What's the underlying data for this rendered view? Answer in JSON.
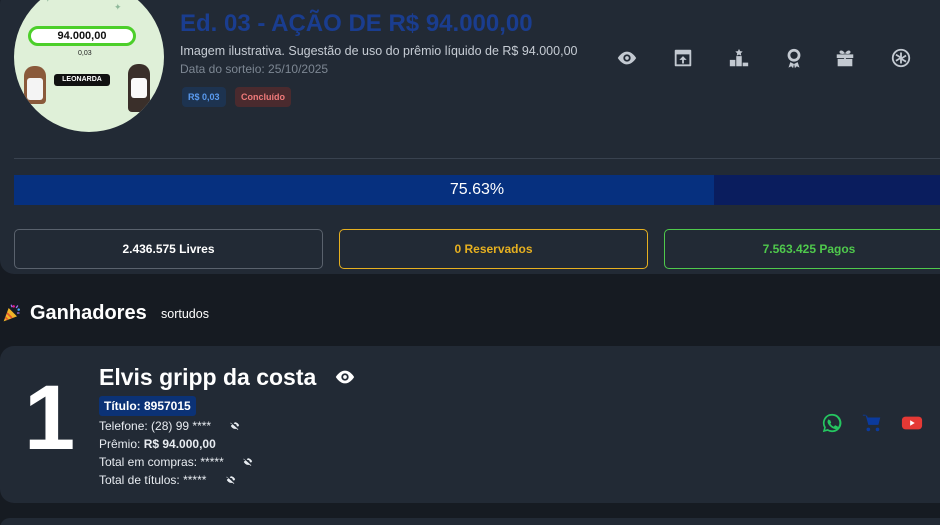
{
  "raffle": {
    "title": "Ed. 03 - AÇÃO DE R$ 94.000,00",
    "subtitle": "Imagem ilustrativa. Sugestão de uso do prêmio líquido de R$ 94.000,00",
    "draw_date": "Data do sorteio: 25/10/2025",
    "price_badge": "R$ 0,03",
    "status_badge": "Concluído",
    "thumbnail": {
      "prize_text": "94.000,00",
      "small_text": "0,03",
      "logo_text": "LEONARDA"
    }
  },
  "actions": [
    {
      "name": "view-icon"
    },
    {
      "name": "share-icon"
    },
    {
      "name": "ranking-icon"
    },
    {
      "name": "award-icon"
    },
    {
      "name": "gift-icon"
    },
    {
      "name": "wheel-icon"
    }
  ],
  "progress": {
    "label": "75.63%",
    "fraction": 0.7563
  },
  "stats": {
    "free": "2.436.575 Livres",
    "reserved": "0 Reservados",
    "paid": "7.563.425 Pagos"
  },
  "winners": {
    "title": "Ganhadores",
    "subtitle": "sortudos",
    "items": [
      {
        "position": "1",
        "name": "Elvis gripp da costa",
        "ticket": "Título: 8957015",
        "phone_label": "Telefone:",
        "phone_value": "(28) 99 ****",
        "prize_label": "Prêmio:",
        "prize_value": "R$ 94.000,00",
        "total_label": "Total em compras:",
        "total_value": "*****",
        "titles_label": "Total de títulos:",
        "titles_value": "*****"
      }
    ]
  },
  "colors": {
    "title": "#1a3d8f",
    "progress_fill": "#06307f",
    "reserved": "#e6b020",
    "paid": "#4fc94c",
    "whatsapp": "#25c660",
    "youtube": "#e53935",
    "cart": "#0b3a9c"
  }
}
